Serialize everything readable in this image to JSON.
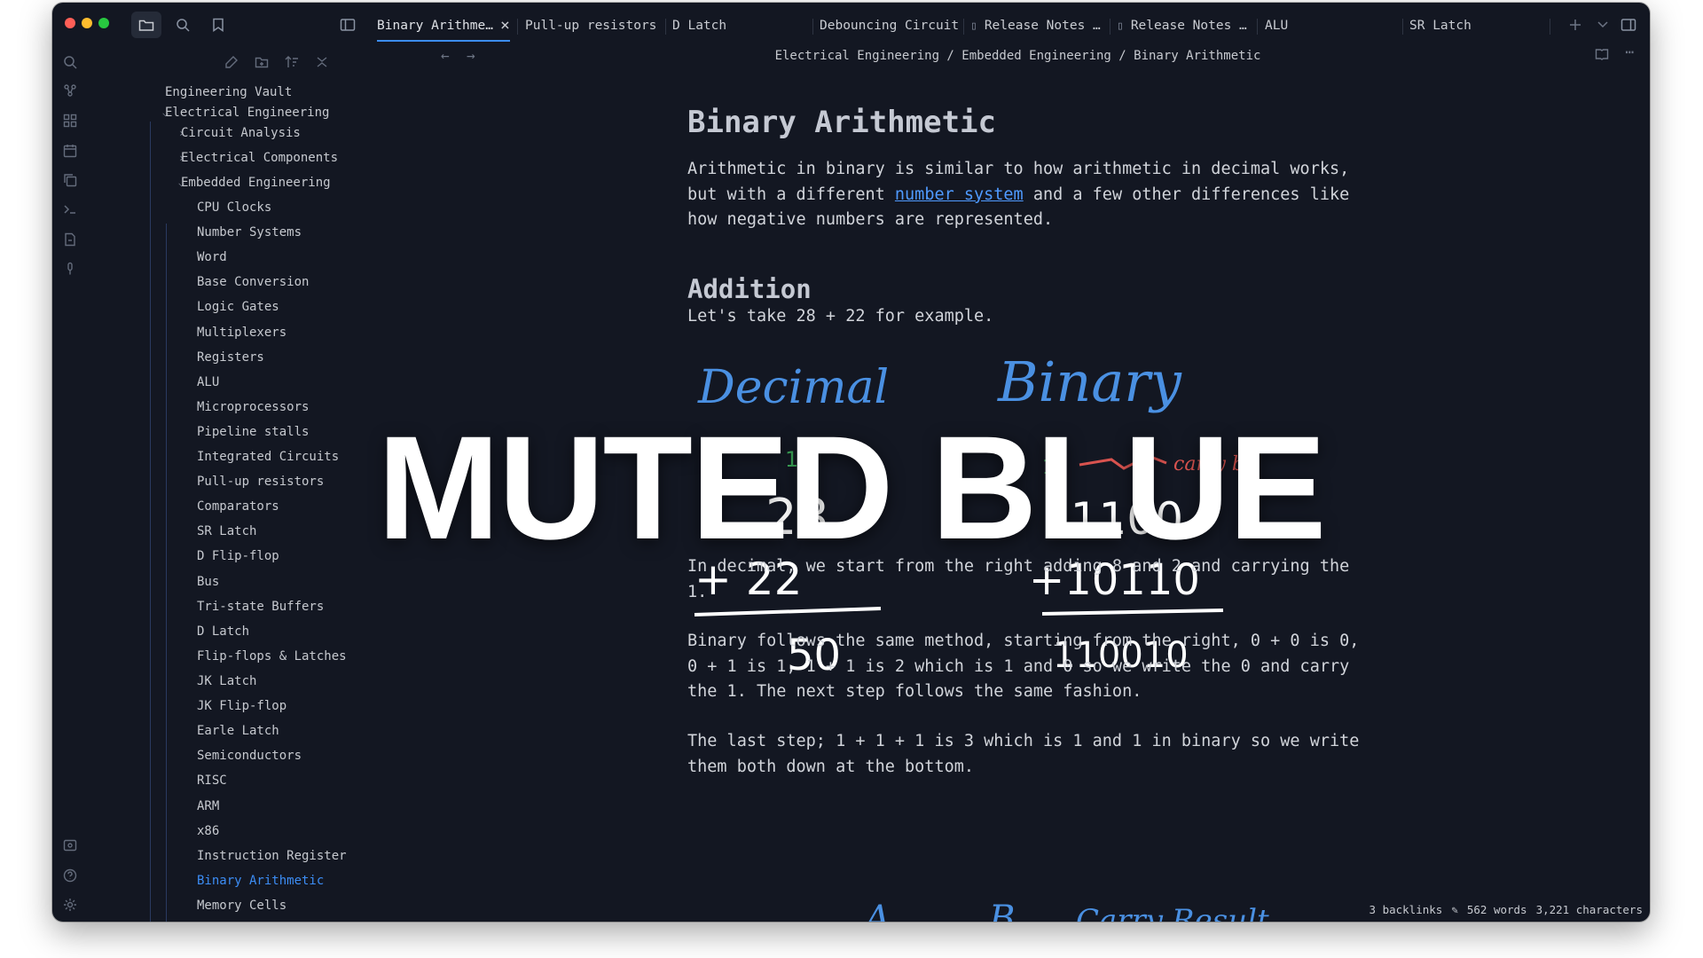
{
  "tabs": [
    {
      "label": "Binary Arithme…",
      "active": true
    },
    {
      "label": "Pull-up resistors"
    },
    {
      "label": "D Latch"
    },
    {
      "label": "Debouncing Circuit"
    },
    {
      "label": "Release Notes …"
    },
    {
      "label": "Release Notes …"
    },
    {
      "label": "ALU"
    },
    {
      "label": "SR Latch"
    }
  ],
  "breadcrumb": "Electrical Engineering / Embedded Engineering / Binary Arithmetic",
  "sidebar": {
    "vault": "Engineering Vault",
    "items": [
      {
        "label": "Electrical Engineering"
      },
      {
        "label": "Circuit Analysis"
      },
      {
        "label": "Electrical Components"
      },
      {
        "label": "Embedded Engineering"
      },
      {
        "label": "CPU Clocks"
      },
      {
        "label": "Number Systems"
      },
      {
        "label": "Word"
      },
      {
        "label": "Base Conversion"
      },
      {
        "label": "Logic Gates"
      },
      {
        "label": "Multiplexers"
      },
      {
        "label": "Registers"
      },
      {
        "label": "ALU"
      },
      {
        "label": "Microprocessors"
      },
      {
        "label": "Pipeline stalls"
      },
      {
        "label": "Integrated Circuits"
      },
      {
        "label": "Pull-up resistors"
      },
      {
        "label": "Comparators"
      },
      {
        "label": "SR Latch"
      },
      {
        "label": "D Flip-flop"
      },
      {
        "label": "Bus"
      },
      {
        "label": "Tri-state Buffers"
      },
      {
        "label": "D Latch"
      },
      {
        "label": "Flip-flops & Latches"
      },
      {
        "label": "JK Latch"
      },
      {
        "label": "JK Flip-flop"
      },
      {
        "label": "Earle Latch"
      },
      {
        "label": "Semiconductors"
      },
      {
        "label": "RISC"
      },
      {
        "label": "ARM"
      },
      {
        "label": "x86"
      },
      {
        "label": "Instruction Register"
      },
      {
        "label": "Binary Arithmetic",
        "active": true
      },
      {
        "label": "Memory Cells"
      }
    ]
  },
  "note": {
    "title": "Binary Arithmetic",
    "intro_before": "Arithmetic in binary is similar to how arithmetic in decimal works, but with a different ",
    "intro_link": "number system",
    "intro_after": " and a few other differences like how negative numbers are represented.",
    "section_addition": "Addition",
    "example": "Let's take 28 + 22 for example.",
    "sketch": {
      "decimal_label": "Decimal",
      "binary_label": "Binary",
      "carry_note": "carry bit",
      "decimal_carry": "1",
      "decimal_top": "28",
      "decimal_add": "+ 22",
      "decimal_result": "50",
      "binary_carry": "1",
      "binary_top": "11100",
      "binary_add": "+10110",
      "binary_result": "110010",
      "col_a": "A",
      "col_b": "B",
      "col_carry": "Carry",
      "col_result": "Result"
    },
    "para1": "In decimal, we start from the right adding 8 and 2 and carrying the 1.",
    "para2": "Binary follows the same method, starting from the right, 0 + 0 is 0, 0 + 1 is 1, 1 + 1 is 2 which is 1 and 0 so we write the 0 and carry the 1. The next step follows the same fashion.",
    "para3": "The last step; 1 + 1 + 1 is 3 which is 1 and 1 in binary so we write them both down at the bottom."
  },
  "status": {
    "backlinks": "3 backlinks",
    "words": "562 words",
    "characters": "3,221 characters"
  },
  "overlay_text": "MUTED BLUE",
  "colors": {
    "accent": "#3c8df5",
    "background": "#131722",
    "ink": "#4a90e2",
    "carry_ink": "#d9534f"
  },
  "icons": [
    "folder-icon",
    "search-icon",
    "bookmark-icon",
    "sidebar-toggle-icon",
    "plus-icon",
    "chevron-down-icon",
    "right-sidebar-icon",
    "graph-icon",
    "canvas-icon",
    "calendar-icon",
    "copy-icon",
    "terminal-icon",
    "template-icon",
    "audio-icon",
    "new-note-icon",
    "new-folder-icon",
    "sort-icon",
    "collapse-icon",
    "help-icon",
    "settings-icon",
    "vault-icon",
    "reading-view-icon",
    "more-options-icon",
    "edit-icon"
  ]
}
